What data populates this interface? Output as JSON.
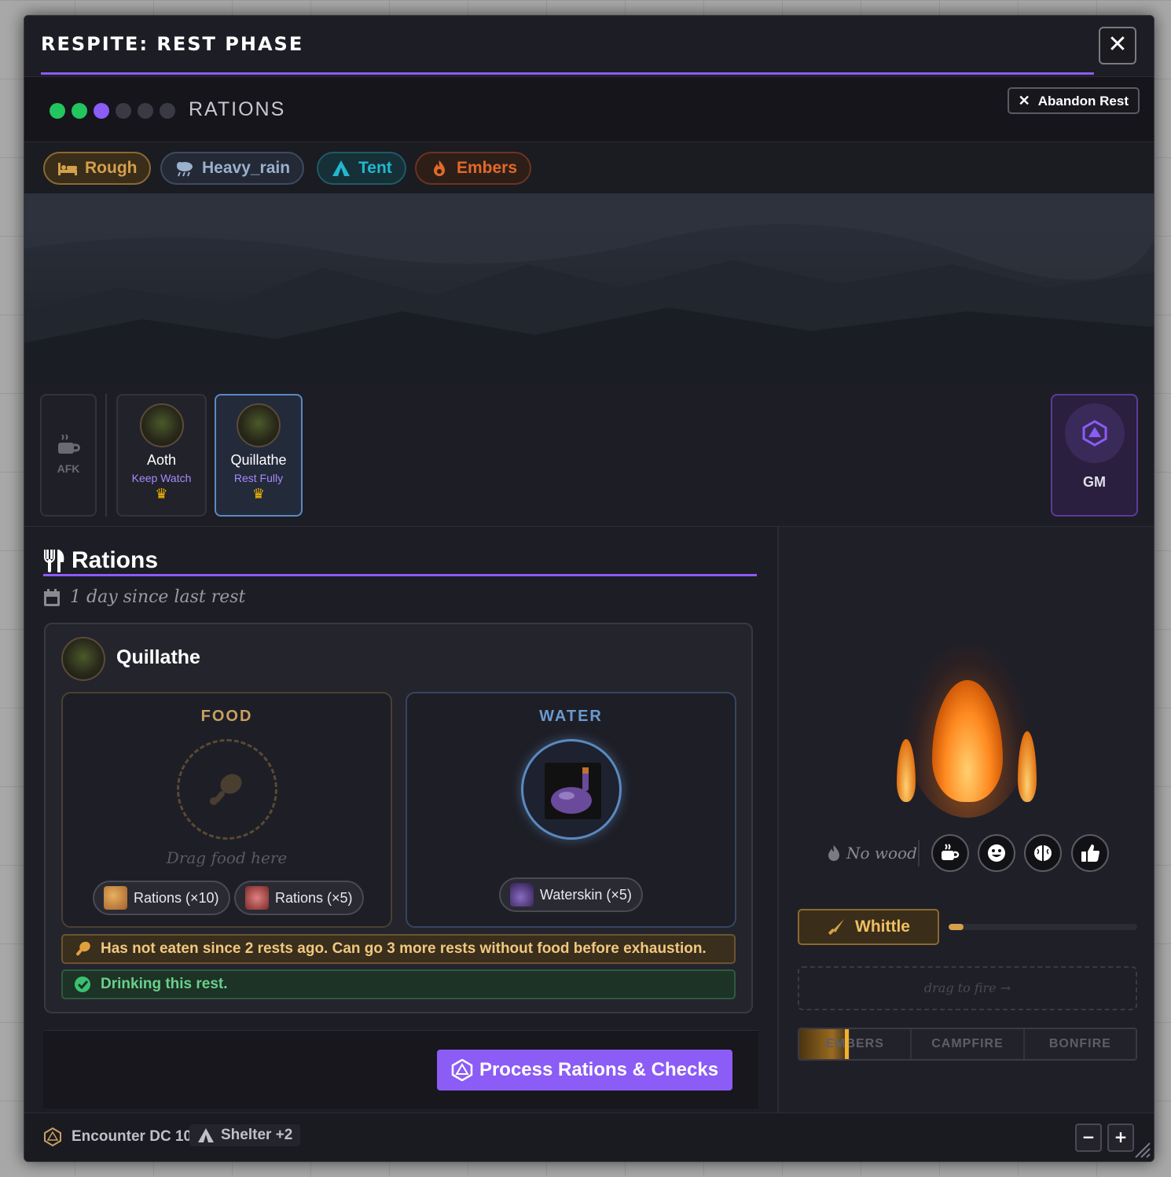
{
  "window": {
    "title": "RESPITE: REST PHASE",
    "close_label": "✕"
  },
  "phase": {
    "label": "RATIONS",
    "abandon_label": "Abandon Rest",
    "dots": [
      {
        "state": "done",
        "color": "#22c55e"
      },
      {
        "state": "done",
        "color": "#22c55e"
      },
      {
        "state": "current",
        "color": "#8b5cf6"
      },
      {
        "state": "pending",
        "color": "#3a3a44"
      },
      {
        "state": "pending",
        "color": "#3a3a44"
      },
      {
        "state": "pending",
        "color": "#3a3a44"
      }
    ]
  },
  "tags": [
    {
      "label": "Rough",
      "icon": "bed-icon",
      "color": "#d4a04a"
    },
    {
      "label": "Heavy_rain",
      "icon": "cloud-rain-icon",
      "color": "#9ab0cc"
    },
    {
      "label": "Tent",
      "icon": "tent-icon",
      "color": "#22b8cf"
    },
    {
      "label": "Embers",
      "icon": "fire-icon",
      "color": "#e06a2a"
    }
  ],
  "roster": {
    "afk_label": "AFK",
    "members": [
      {
        "name": "Aoth",
        "activity": "Keep Watch"
      },
      {
        "name": "Quillathe",
        "activity": "Rest Fully"
      }
    ],
    "gm_label": "GM"
  },
  "rations": {
    "title": "Rations",
    "since": "1 day since last rest",
    "character": "Quillathe",
    "food": {
      "label": "FOOD",
      "placeholder": "Drag food here",
      "items": [
        "Rations (×10)",
        "Rations (×5)"
      ]
    },
    "water": {
      "label": "WATER",
      "items": [
        "Waterskin (×5)"
      ]
    },
    "warning": "Has not eaten since 2 rests ago. Can go 3 more rests without food before exhaustion.",
    "ok": "Drinking this rest.",
    "process_label": "Process Rations & Checks"
  },
  "campfire": {
    "no_wood": "No wood",
    "whittle_label": "Whittle",
    "whittle_progress": 0.08,
    "drop_hint": "drag to fire →",
    "levels": [
      "EMBERS",
      "CAMPFIRE",
      "BONFIRE"
    ],
    "current_level": "EMBERS"
  },
  "footer": {
    "encounter": "Encounter DC 10",
    "shelter": "Shelter +2",
    "zoom_out": "−",
    "zoom_in": "+"
  },
  "colors": {
    "accent": "#8b5cf6",
    "food": "#c8a060",
    "water": "#6a9ad0",
    "warning_bg": "#3a2e1c",
    "ok_bg": "#1c3326"
  }
}
